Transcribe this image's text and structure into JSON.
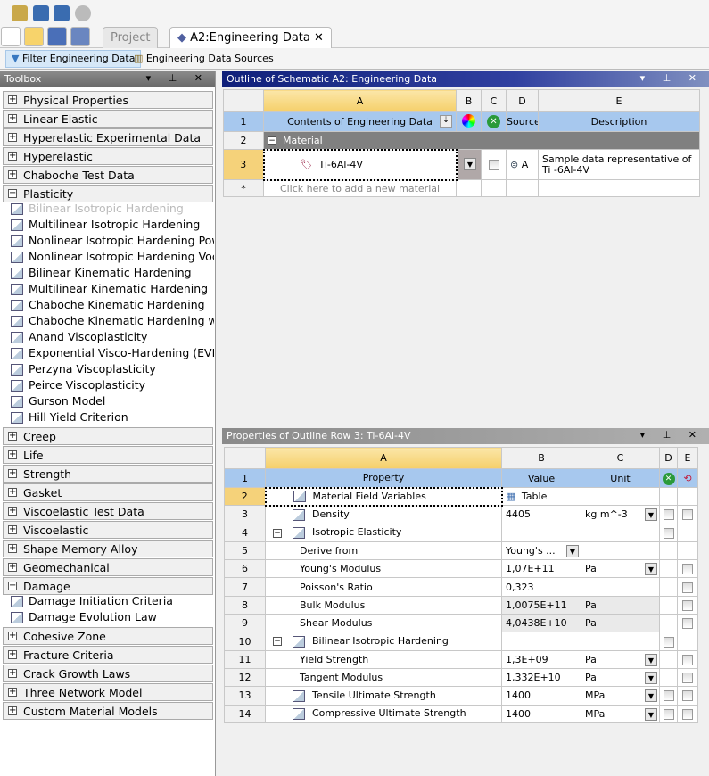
{
  "tabs": [
    {
      "label": "Project"
    },
    {
      "label": "A2:Engineering Data"
    }
  ],
  "toolbar": {
    "filter": "Filter Engineering Data",
    "sources": "Engineering Data Sources"
  },
  "toolbox": {
    "title": "Toolbox",
    "groups_top": [
      "Physical Properties",
      "Linear Elastic",
      "Hyperelastic Experimental Data",
      "Hyperelastic",
      "Chaboche Test Data"
    ],
    "plasticity": {
      "label": "Plasticity",
      "items": [
        "Bilinear Isotropic Hardening",
        "Multilinear Isotropic Hardening",
        "Nonlinear Isotropic Hardening Power Law",
        "Nonlinear Isotropic Hardening Voce Law",
        "Bilinear Kinematic Hardening",
        "Multilinear Kinematic Hardening",
        "Chaboche Kinematic Hardening",
        "Chaboche Kinematic Hardening w/ Static Recovery",
        "Anand Viscoplasticity",
        "Exponential Visco-Hardening (EVH)",
        "Perzyna Viscoplasticity",
        "Peirce Viscoplasticity",
        "Gurson Model",
        "Hill Yield Criterion"
      ]
    },
    "groups_mid": [
      "Creep",
      "Life",
      "Strength",
      "Gasket",
      "Viscoelastic Test Data",
      "Viscoelastic",
      "Shape Memory Alloy",
      "Geomechanical"
    ],
    "damage": {
      "label": "Damage",
      "items": [
        "Damage Initiation Criteria",
        "Damage Evolution Law"
      ]
    },
    "groups_bottom": [
      "Cohesive Zone",
      "Fracture Criteria",
      "Crack Growth Laws",
      "Three Network Model",
      "Custom Material Models"
    ]
  },
  "outline": {
    "title": "Outline of Schematic A2: Engineering Data",
    "cols": [
      "A",
      "B",
      "C",
      "D",
      "E"
    ],
    "header": {
      "num": "1",
      "contents": "Contents of Engineering Data",
      "source": "Source",
      "description": "Description"
    },
    "group": {
      "num": "2",
      "label": "Material"
    },
    "row": {
      "num": "3",
      "name": "Ti-6Al-4V",
      "source": "A",
      "description": "Sample data representative of Ti -6Al-4V"
    },
    "add": {
      "num": "*",
      "label": "Click here to add a new material"
    }
  },
  "properties": {
    "title": "Properties of Outline Row 3: Ti-6Al-4V",
    "cols": [
      "A",
      "B",
      "C",
      "D",
      "E"
    ],
    "header": {
      "num": "1",
      "property": "Property",
      "value": "Value",
      "unit": "Unit"
    },
    "rows": [
      {
        "num": "2",
        "name": "Material Field Variables",
        "value": "Table",
        "unit": "",
        "level": 0,
        "icon": true,
        "d": false,
        "e": false
      },
      {
        "num": "3",
        "name": "Density",
        "value": "4405",
        "unit": "kg m^-3",
        "level": 0,
        "icon": true,
        "dd": true,
        "d": true,
        "e": true
      },
      {
        "num": "4",
        "name": "Isotropic Elasticity",
        "value": "",
        "unit": "",
        "level": 0,
        "icon": true,
        "expand": true,
        "d": true,
        "e": false
      },
      {
        "num": "5",
        "name": "Derive from",
        "value": "Young's ...",
        "unit": "",
        "level": 1,
        "vdd": true
      },
      {
        "num": "6",
        "name": "Young's Modulus",
        "value": "1,07E+11",
        "unit": "Pa",
        "level": 1,
        "dd": true,
        "e": true
      },
      {
        "num": "7",
        "name": "Poisson's Ratio",
        "value": "0,323",
        "unit": "",
        "level": 1,
        "e": true
      },
      {
        "num": "8",
        "name": "Bulk Modulus",
        "value": "1,0075E+11",
        "unit": "Pa",
        "level": 1,
        "e": true,
        "ro": true
      },
      {
        "num": "9",
        "name": "Shear Modulus",
        "value": "4,0438E+10",
        "unit": "Pa",
        "level": 1,
        "e": true,
        "ro": true
      },
      {
        "num": "10",
        "name": "Bilinear Isotropic Hardening",
        "value": "",
        "unit": "",
        "level": 0,
        "icon": true,
        "expand": true,
        "d": true
      },
      {
        "num": "11",
        "name": "Yield Strength",
        "value": "1,3E+09",
        "unit": "Pa",
        "level": 1,
        "dd": true,
        "e": true
      },
      {
        "num": "12",
        "name": "Tangent Modulus",
        "value": "1,332E+10",
        "unit": "Pa",
        "level": 1,
        "dd": true,
        "e": true
      },
      {
        "num": "13",
        "name": "Tensile Ultimate Strength",
        "value": "1400",
        "unit": "MPa",
        "level": 0,
        "icon": true,
        "dd": true,
        "d": true,
        "e": true
      },
      {
        "num": "14",
        "name": "Compressive Ultimate Strength",
        "value": "1400",
        "unit": "MPa",
        "level": 0,
        "icon": true,
        "dd": true,
        "d": true,
        "e": true
      }
    ]
  }
}
